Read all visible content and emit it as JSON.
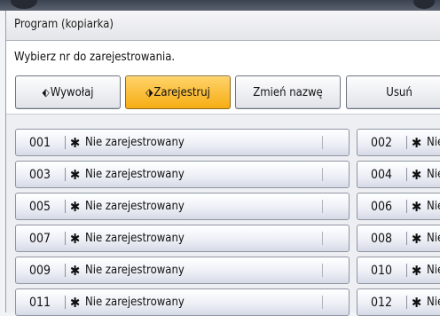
{
  "window": {
    "title": "Program (kopiarka)"
  },
  "instruction": "Wybierz nr do zarejestrowania.",
  "toolbar": {
    "recall_label": "Wywołaj",
    "register_label": "Zarejestruj",
    "rename_label": "Zmień nazwę",
    "delete_label": "Usuń",
    "active": "Zarejestruj"
  },
  "programs": [
    {
      "number": "001",
      "star": "✱",
      "name": "Nie zarejestrowany"
    },
    {
      "number": "002",
      "star": "✱",
      "name": "Nie zarejestrowany"
    },
    {
      "number": "003",
      "star": "✱",
      "name": "Nie zarejestrowany"
    },
    {
      "number": "004",
      "star": "✱",
      "name": "Nie zarejestrowany"
    },
    {
      "number": "005",
      "star": "✱",
      "name": "Nie zarejestrowany"
    },
    {
      "number": "006",
      "star": "✱",
      "name": "Nie zarejestrowany"
    },
    {
      "number": "007",
      "star": "✱",
      "name": "Nie zarejestrowany"
    },
    {
      "number": "008",
      "star": "✱",
      "name": "Nie zarejestrowany"
    },
    {
      "number": "009",
      "star": "✱",
      "name": "Nie zarejestrowany"
    },
    {
      "number": "010",
      "star": "✱",
      "name": "Nie zarejestrowany"
    },
    {
      "number": "011",
      "star": "✱",
      "name": "Nie zarejestrowany"
    },
    {
      "number": "012",
      "star": "✱",
      "name": "Nie zarejestrowany"
    }
  ],
  "colors": {
    "active_button": "#f6ad14",
    "row_border": "#8e95a3"
  }
}
